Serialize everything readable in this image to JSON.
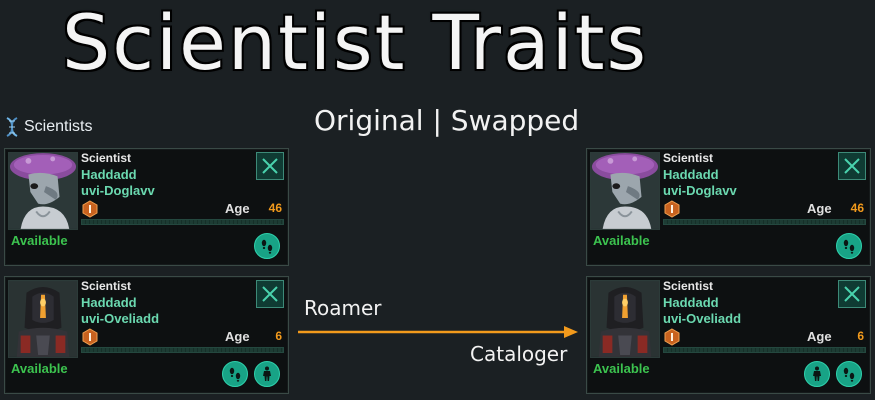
{
  "header": {
    "title": "Scientist Traits",
    "subtitle": "Original | Swapped"
  },
  "panel": {
    "label": "Scientists",
    "icon": "dna-icon"
  },
  "annotation": {
    "from_trait": "Roamer",
    "to_trait": "Cataloger",
    "arrow_color": "#f29a1c"
  },
  "cards": {
    "left": [
      {
        "class": "Scientist",
        "name_line1": "Haddadd",
        "name_line2": "uvi-Doglavv",
        "age_label": "Age",
        "age": "46",
        "status": "Available",
        "portrait": "mushroom-cap-alien"
      },
      {
        "class": "Scientist",
        "name_line1": "Haddadd",
        "name_line2": "uvi-Oveliadd",
        "age_label": "Age",
        "age": "6",
        "status": "Available",
        "portrait": "armored-robot-alien"
      }
    ],
    "right": [
      {
        "class": "Scientist",
        "name_line1": "Haddadd",
        "name_line2": "uvi-Doglavv",
        "age_label": "Age",
        "age": "46",
        "status": "Available",
        "portrait": "mushroom-cap-alien"
      },
      {
        "class": "Scientist",
        "name_line1": "Haddadd",
        "name_line2": "uvi-Oveliadd",
        "age_label": "Age",
        "age": "6",
        "status": "Available",
        "portrait": "armored-robot-alien"
      }
    ]
  },
  "colors": {
    "name_green": "#6bd9b0",
    "status_green": "#3cc34f",
    "age_orange": "#f29a1c",
    "button_teal": "#18a386"
  }
}
